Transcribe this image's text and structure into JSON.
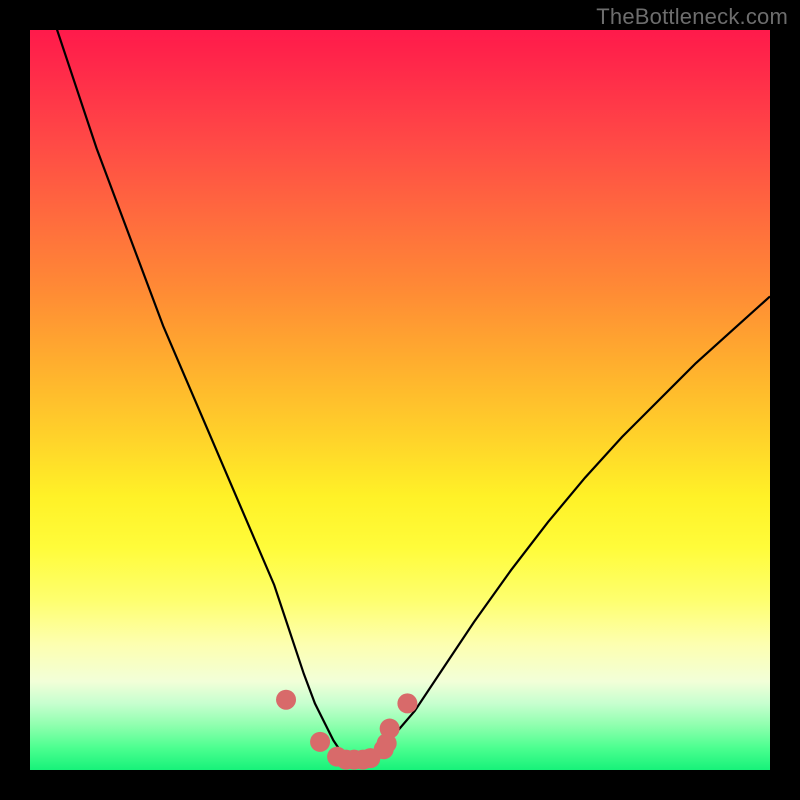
{
  "watermark": "TheBottleneck.com",
  "colors": {
    "frame": "#000000",
    "curve": "#000000",
    "marker_fill": "#d86a6a",
    "marker_stroke": "#d86a6a",
    "gradient_top": "#ff1a4b",
    "gradient_bottom": "#17f27a"
  },
  "chart_data": {
    "type": "line",
    "title": "",
    "xlabel": "",
    "ylabel": "",
    "xlim": [
      0,
      100
    ],
    "ylim": [
      0,
      100
    ],
    "x": [
      0,
      3,
      6,
      9,
      12,
      15,
      18,
      21,
      24,
      27,
      30,
      33,
      35,
      37,
      38.5,
      40,
      41,
      42,
      43,
      44,
      45,
      47,
      49,
      52,
      56,
      60,
      65,
      70,
      75,
      80,
      85,
      90,
      95,
      100
    ],
    "values": [
      112,
      102,
      93,
      84,
      76,
      68,
      60,
      53,
      46,
      39,
      32,
      25,
      19,
      13,
      9,
      6,
      4,
      2.5,
      1.8,
      1.4,
      1.6,
      2.5,
      4.5,
      8,
      14,
      20,
      27,
      33.5,
      39.5,
      45,
      50,
      55,
      59.5,
      64
    ],
    "markers": {
      "x": [
        34.6,
        39.2,
        41.5,
        42.7,
        43.8,
        45.0,
        46.0,
        47.8,
        48.2,
        48.6,
        51.0
      ],
      "y": [
        9.5,
        3.8,
        1.8,
        1.4,
        1.4,
        1.4,
        1.6,
        2.8,
        3.6,
        5.6,
        9.0
      ]
    }
  }
}
